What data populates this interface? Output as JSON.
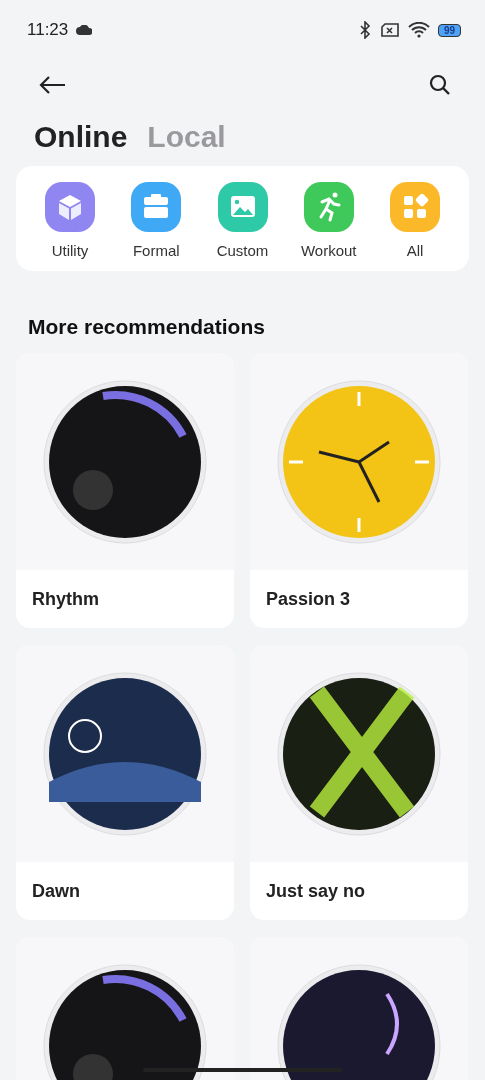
{
  "status_bar": {
    "time": "11:23",
    "battery": "99"
  },
  "tabs": [
    {
      "label": "Online",
      "selected": true
    },
    {
      "label": "Local",
      "selected": false
    }
  ],
  "categories": [
    {
      "label": "Utility",
      "kind": "cube",
      "color": "#8f86f2"
    },
    {
      "label": "Formal",
      "kind": "briefcase",
      "color": "#3fa9f5"
    },
    {
      "label": "Custom",
      "kind": "image",
      "color": "#2ec9a6"
    },
    {
      "label": "Workout",
      "kind": "runner",
      "color": "#3ec95a"
    },
    {
      "label": "All",
      "kind": "grid",
      "color": "#fbb929"
    }
  ],
  "section_title": "More recommendations",
  "watch_faces": [
    {
      "name": "Rhythm",
      "kind": "dark"
    },
    {
      "name": "Passion 3",
      "kind": "yellow"
    },
    {
      "name": "Dawn",
      "kind": "night"
    },
    {
      "name": "Just say no",
      "kind": "green"
    },
    {
      "kind": "dark"
    },
    {
      "kind": "purple"
    }
  ]
}
